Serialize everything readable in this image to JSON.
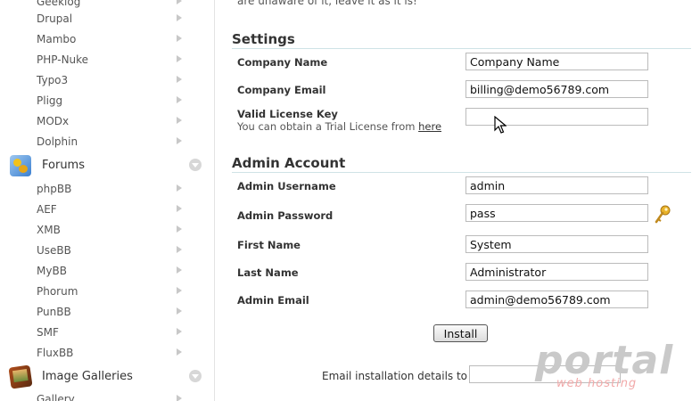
{
  "sidebar": {
    "items_top": [
      {
        "label": "Geeklog"
      },
      {
        "label": "Drupal"
      },
      {
        "label": "Mambo"
      },
      {
        "label": "PHP-Nuke"
      },
      {
        "label": "Typo3"
      },
      {
        "label": "Pligg"
      },
      {
        "label": "MODx"
      },
      {
        "label": "Dolphin"
      }
    ],
    "forums": {
      "label": "Forums",
      "items": [
        {
          "label": "phpBB"
        },
        {
          "label": "AEF"
        },
        {
          "label": "XMB"
        },
        {
          "label": "UseBB"
        },
        {
          "label": "MyBB"
        },
        {
          "label": "Phorum"
        },
        {
          "label": "PunBB"
        },
        {
          "label": "SMF"
        },
        {
          "label": "FluxBB"
        }
      ]
    },
    "galleries": {
      "label": "Image Galleries",
      "items": [
        {
          "label": "Gallery"
        }
      ]
    }
  },
  "main": {
    "top_note": "are unaware of it, leave it as it is!",
    "settings": {
      "title": "Settings",
      "company_name": {
        "label": "Company Name",
        "value": "Company Name"
      },
      "company_email": {
        "label": "Company Email",
        "value": "billing@demo56789.com"
      },
      "license": {
        "label": "Valid License Key",
        "value": "",
        "sub_text": "You can obtain a Trial License from",
        "link_text": "here"
      }
    },
    "admin": {
      "title": "Admin Account",
      "username": {
        "label": "Admin Username",
        "value": "admin"
      },
      "password": {
        "label": "Admin Password",
        "value": "pass"
      },
      "first_name": {
        "label": "First Name",
        "value": "System"
      },
      "last_name": {
        "label": "Last Name",
        "value": "Administrator"
      },
      "email": {
        "label": "Admin Email",
        "value": "admin@demo56789.com"
      }
    },
    "install_label": "Install",
    "email_details_label": "Email installation details to :",
    "email_details_value": ""
  },
  "watermark": {
    "main": "portal",
    "sub": "web hosting"
  },
  "colors": {
    "section_underline": "#cfe3e6",
    "watermark_main": "#c9c9c9",
    "watermark_sub": "#f2a9a9",
    "arrow": "#c8c8c8"
  },
  "icons": {
    "category_forums": "forums-icon",
    "category_galleries": "image-galleries-icon",
    "password_generator": "key-icon",
    "collapse": "chevron-down-icon",
    "expand": "arrow-right-icon"
  }
}
